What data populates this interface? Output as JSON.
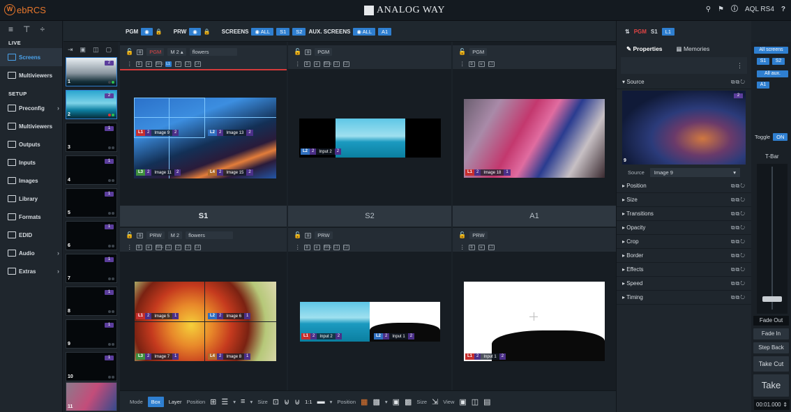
{
  "app": {
    "logo_text": "ebRCS",
    "brand": "ANALOG WAY",
    "device": "AQL RS4"
  },
  "nav": {
    "live_label": "LIVE",
    "setup_label": "SETUP",
    "items": [
      {
        "label": "Screens",
        "icon": "screens-icon"
      },
      {
        "label": "Multiviewers",
        "icon": "multiviewer-icon"
      }
    ],
    "setup_items": [
      {
        "label": "Preconfig",
        "icon": "preconfig-icon"
      },
      {
        "label": "Multiviewers",
        "icon": "multiviewers-icon"
      },
      {
        "label": "Outputs",
        "icon": "outputs-icon"
      },
      {
        "label": "Inputs",
        "icon": "inputs-icon"
      },
      {
        "label": "Images",
        "icon": "images-icon"
      },
      {
        "label": "Library",
        "icon": "library-icon"
      },
      {
        "label": "Formats",
        "icon": "formats-icon"
      },
      {
        "label": "EDID",
        "icon": "edid-icon"
      },
      {
        "label": "Audio",
        "icon": "audio-icon"
      },
      {
        "label": "Extras",
        "icon": "extras-icon"
      }
    ]
  },
  "strip": {
    "pgm": "PGM",
    "prw": "PRW",
    "screens": "SCREENS",
    "all": "ALL",
    "s1": "S1",
    "s2": "S2",
    "aux": "AUX. SCREENS",
    "a1": "A1"
  },
  "thumbs": [
    {
      "n": "1",
      "b": "2"
    },
    {
      "n": "2",
      "b": "2"
    },
    {
      "n": "3",
      "b": "1"
    },
    {
      "n": "4",
      "b": "1"
    },
    {
      "n": "5",
      "b": "1"
    },
    {
      "n": "6",
      "b": "1"
    },
    {
      "n": "7",
      "b": "1"
    },
    {
      "n": "8",
      "b": "1"
    },
    {
      "n": "9",
      "b": "1"
    },
    {
      "n": "10",
      "b": "1"
    },
    {
      "n": "11",
      "b": ""
    }
  ],
  "screens": {
    "s1": {
      "title": "S1",
      "pgm_label": "PGM",
      "prw_label": "PRW",
      "mem": "M 2",
      "mem_prw": "M 2",
      "preset": "flowers",
      "preset_prw": "flowers",
      "pgm_layers": [
        {
          "l": "L1",
          "n": "2",
          "t": "Image 9",
          "n2": "2"
        },
        {
          "l": "L2",
          "n": "2",
          "t": "Image 13",
          "n2": "2"
        },
        {
          "l": "L3",
          "n": "2",
          "t": "Image 11",
          "n2": "2"
        },
        {
          "l": "L4",
          "n": "2",
          "t": "Image 15",
          "n2": "2"
        }
      ],
      "prw_layers": [
        {
          "l": "L1",
          "n": "2",
          "t": "Image 5",
          "n2": "1"
        },
        {
          "l": "L2",
          "n": "2",
          "t": "Image 6",
          "n2": "1"
        },
        {
          "l": "L3",
          "n": "2",
          "t": "Image 7",
          "n2": "1"
        },
        {
          "l": "L4",
          "n": "2",
          "t": "Image 8",
          "n2": "1"
        }
      ]
    },
    "s2": {
      "title": "S2",
      "pgm_label": "PGM",
      "prw_label": "PRW",
      "pgm_layers": [
        {
          "l": "L2",
          "n": "2",
          "t": "Input 2",
          "n2": "2"
        }
      ],
      "prw_layers": [
        {
          "l": "L1",
          "n": "2",
          "t": "Input 2",
          "n2": "2"
        },
        {
          "l": "L2",
          "n": "2",
          "t": "Input 1",
          "n2": "2"
        }
      ]
    },
    "a1": {
      "title": "A1",
      "pgm_label": "PGM",
      "prw_label": "PRW",
      "pgm_layers": [
        {
          "l": "L1",
          "n": "2",
          "t": "Image 18",
          "n2": "1"
        }
      ],
      "prw_layers": [
        {
          "l": "L1",
          "n": "2",
          "t": "Input 1",
          "n2": "2"
        }
      ]
    }
  },
  "bottombar": {
    "mode": "Mode",
    "box": "Box",
    "layer": "Layer",
    "position": "Position",
    "size": "Size",
    "ratio": "1:1",
    "position2": "Position",
    "size2": "Size",
    "view": "View"
  },
  "right": {
    "pgm": "PGM",
    "s1": "S1",
    "l1": "L1",
    "tab_props": "Properties",
    "tab_mem": "Memories",
    "source_section": "Source",
    "source_label": "Source",
    "source_value": "Image 9",
    "src_num": "9",
    "src_badge": "2",
    "props": [
      "Position",
      "Size",
      "Transitions",
      "Opacity",
      "Crop",
      "Border",
      "Effects",
      "Speed",
      "Timing"
    ]
  },
  "far": {
    "all_screens": "All screens",
    "s1": "S1",
    "s2": "S2",
    "all_aux": "All aux.",
    "a1": "A1",
    "toggle": "Toggle",
    "on": "ON",
    "tbar": "T-Bar",
    "fade_out": "Fade Out",
    "fade_in": "Fade In",
    "step_back": "Step Back",
    "take_cut": "Take Cut",
    "take": "Take",
    "time": "00:01.000"
  }
}
